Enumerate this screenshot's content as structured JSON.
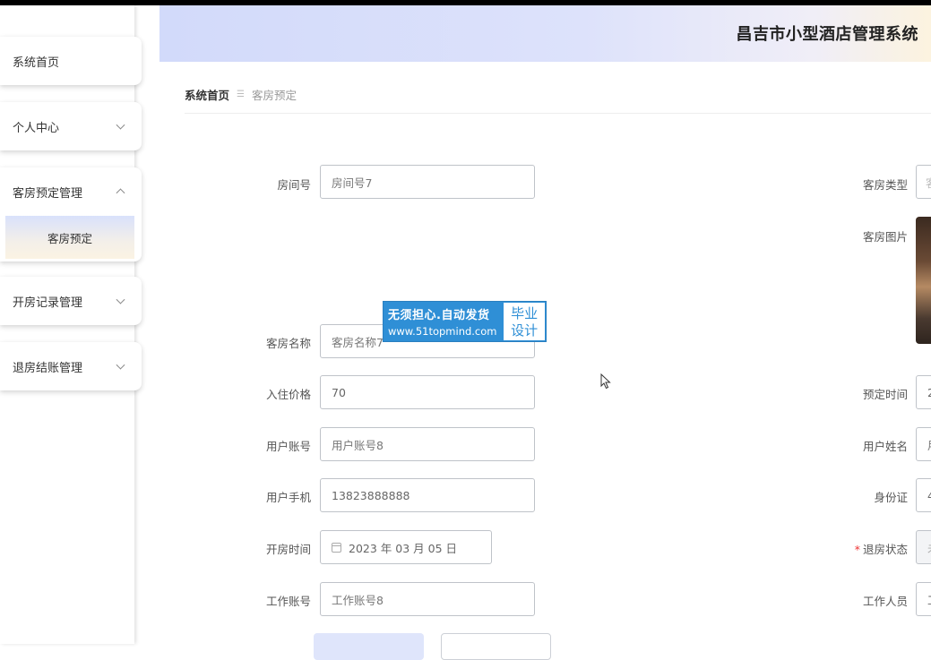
{
  "app": {
    "title": "昌吉市小型酒店管理系统"
  },
  "sidebar": {
    "items": [
      {
        "label": "系统首页"
      },
      {
        "label": "个人中心"
      },
      {
        "label": "客房预定管理",
        "children": [
          {
            "label": "客房预定"
          }
        ]
      },
      {
        "label": "开房记录管理"
      },
      {
        "label": "退房结账管理"
      }
    ]
  },
  "breadcrumb": {
    "home": "系统首页",
    "current": "客房预定"
  },
  "form": {
    "room_no": {
      "label": "房间号",
      "value": "房间号7"
    },
    "room_name": {
      "label": "客房名称",
      "value": "客房名称7"
    },
    "price": {
      "label": "入住价格",
      "value": "70"
    },
    "user_account": {
      "label": "用户账号",
      "value": "用户账号8"
    },
    "user_phone": {
      "label": "用户手机",
      "value": "13823888888"
    },
    "checkin_time": {
      "label": "开房时间",
      "value": "2023 年 03 月 05 日"
    },
    "work_account": {
      "label": "工作账号",
      "value": "工作账号8"
    },
    "room_type": {
      "label": "客房类型",
      "value": "客"
    },
    "room_image": {
      "label": "客房图片"
    },
    "reserve_time": {
      "label": "预定时间",
      "value": "2"
    },
    "user_name": {
      "label": "用户姓名",
      "value": "用"
    },
    "id_card": {
      "label": "身份证",
      "value": "4"
    },
    "checkout_status": {
      "label": "退房状态",
      "required": "*",
      "value": "未"
    },
    "staff": {
      "label": "工作人员",
      "value": "工"
    }
  },
  "watermark": {
    "line1": "无须担心.自动发货",
    "line2": "www.51topmind.com",
    "badge_line1": "毕业",
    "badge_line2": "设计"
  }
}
